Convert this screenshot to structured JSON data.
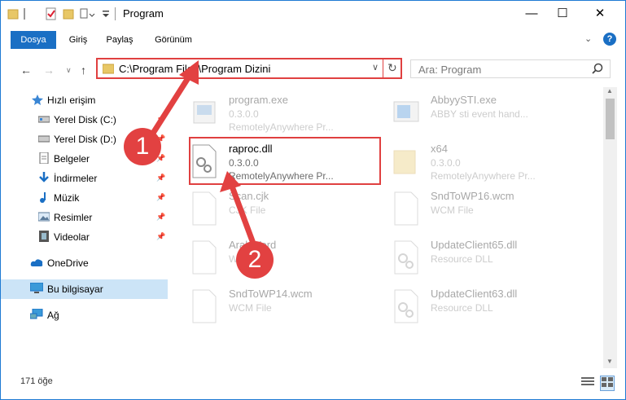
{
  "window": {
    "title": "Program",
    "controls": {
      "minimize": "—",
      "maximize": "☐",
      "close": "✕"
    }
  },
  "ribbon": {
    "tabs": [
      "Dosya",
      "Giriş",
      "Paylaş",
      "Görünüm"
    ]
  },
  "address": {
    "path": "C:\\Program Files\\Program Dizini",
    "search_placeholder": "Ara: Program"
  },
  "sidebar": {
    "items": [
      {
        "label": "Hızlı erişim",
        "icon": "star-icon"
      },
      {
        "label": "Yerel Disk (C:)",
        "icon": "drive-icon",
        "pinned": true
      },
      {
        "label": "Yerel Disk (D:)",
        "icon": "drive-icon",
        "pinned": true
      },
      {
        "label": "Belgeler",
        "icon": "document-icon",
        "pinned": true
      },
      {
        "label": "İndirmeler",
        "icon": "download-icon",
        "pinned": true
      },
      {
        "label": "Müzik",
        "icon": "music-icon",
        "pinned": true
      },
      {
        "label": "Resimler",
        "icon": "pictures-icon",
        "pinned": true
      },
      {
        "label": "Videolar",
        "icon": "video-icon",
        "pinned": true
      },
      {
        "label": "OneDrive",
        "icon": "cloud-icon"
      },
      {
        "label": "Bu bilgisayar",
        "icon": "computer-icon",
        "selected": true
      },
      {
        "label": "Ağ",
        "icon": "network-icon"
      }
    ]
  },
  "files": [
    {
      "name": "program.exe",
      "line1": "0.3.0.0",
      "line2": "RemotelyAnywhere Pr...",
      "faded": true
    },
    {
      "name": "AbbyySTI.exe",
      "line1": "ABBY sti event hand...",
      "line2": "",
      "faded": true
    },
    {
      "name": "raproc.dll",
      "line1": "0.3.0.0",
      "line2": "RemotelyAnywhere Pr...",
      "faded": false
    },
    {
      "name": "x64",
      "line1": "0.3.0.0",
      "line2": "RemotelyAnywhere Pr...",
      "faded": true
    },
    {
      "name": "Scan.cjk",
      "line1": "CJK File",
      "line2": "",
      "faded": true
    },
    {
      "name": "SndToWP16.wcm",
      "line1": "WCM File",
      "line2": "",
      "faded": true
    },
    {
      "name": "ArabWord",
      "line1": "W",
      "line2": "",
      "faded": true
    },
    {
      "name": "UpdateClient65.dll",
      "line1": "Resource DLL",
      "line2": "",
      "faded": true
    },
    {
      "name": "SndToWP14.wcm",
      "line1": "WCM File",
      "line2": "",
      "faded": true
    },
    {
      "name": "UpdateClient63.dll",
      "line1": "Resource DLL",
      "line2": "",
      "faded": true
    }
  ],
  "status": {
    "item_count": "171 öğe"
  },
  "callouts": [
    "1",
    "2"
  ],
  "colors": {
    "accent": "#1a6fc4",
    "highlight": "#e04040",
    "selection": "#cce4f7"
  }
}
